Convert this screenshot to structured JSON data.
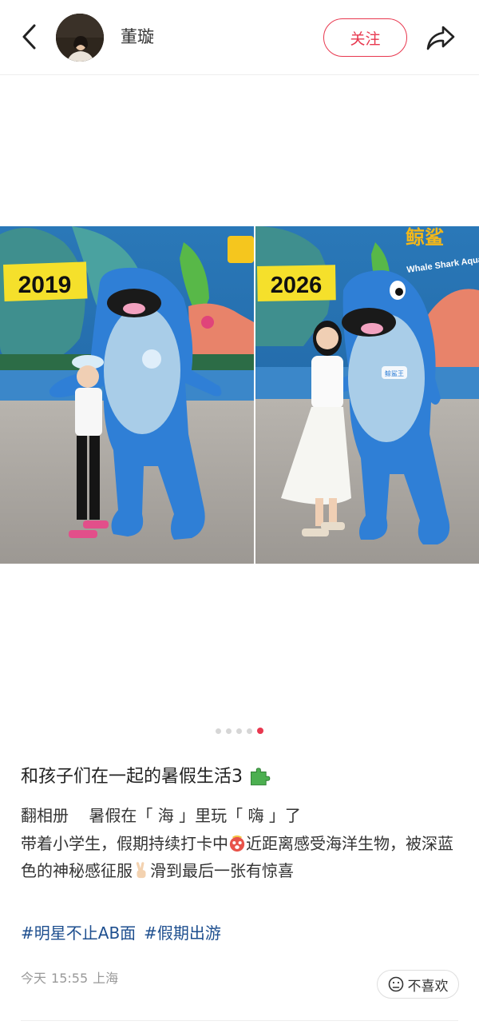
{
  "header": {
    "author_name": "董璇",
    "follow_label": "关注"
  },
  "image": {
    "left_year": "2019",
    "right_year": "2026",
    "sign_text": "鲸鲨",
    "sign_subtext": "Whale Shark Aquarium",
    "badge_text": "鲸鲨王",
    "carousel": {
      "total": 5,
      "active_index": 4
    }
  },
  "post": {
    "title": "和孩子们在一起的暑假生活3",
    "body_line1": "翻相册    暑假在「 海 」里玩「 嗨 」了",
    "body_line2a": "带着小学生，假期持续打卡中",
    "body_line2b": "近距离感受海洋生物，被深蓝色的神秘感征服",
    "body_line2c": "滑到最后一张有惊喜",
    "hashtags": [
      "#明星不止AB面",
      "#假期出游"
    ]
  },
  "meta": {
    "date": "今天",
    "time": "15:55",
    "location": "上海",
    "dislike_label": "不喜欢"
  },
  "colors": {
    "accent": "#e8384f",
    "hashtag": "#1e4f8f",
    "year_tag": "#f5e02b"
  }
}
